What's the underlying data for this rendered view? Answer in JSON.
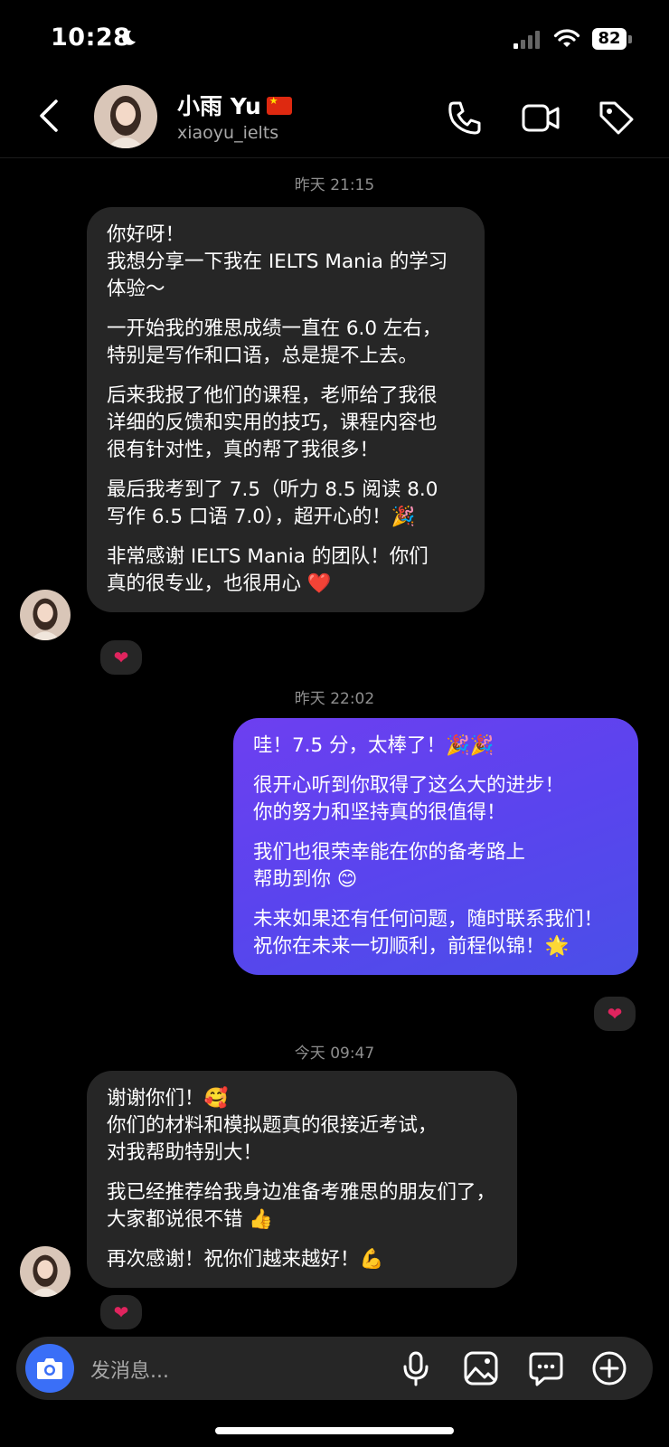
{
  "status_bar": {
    "time": "10:28",
    "battery": "82"
  },
  "header": {
    "name": "小雨 Yu",
    "username": "xiaoyu_ielts"
  },
  "messages": [
    {
      "timestamp": "昨天 21:15",
      "paragraphs": [
        "你好呀！\n我想分享一下我在 IELTS Mania 的学习\n体验～",
        "一开始我的雅思成绩一直在 6.0 左右，\n特别是写作和口语，总是提不上去。",
        "后来我报了他们的课程，老师给了我很\n详细的反馈和实用的技巧，课程内容也\n很有针对性，真的帮了我很多！",
        "最后我考到了 7.5（听力 8.5 阅读 8.0\n写作 6.5 口语 7.0），超开心的！🎉",
        "非常感谢 IELTS Mania 的团队！你们\n真的很专业，也很用心 ❤️"
      ],
      "reaction": "❤"
    },
    {
      "timestamp": "昨天 22:02",
      "paragraphs": [
        "哇！7.5 分，太棒了！🎉🎉",
        "很开心听到你取得了这么大的进步！\n你的努力和坚持真的很值得！",
        "我们也很荣幸能在你的备考路上\n帮助到你 😊",
        "未来如果还有任何问题，随时联系我们！\n祝你在未来一切顺利，前程似锦！🌟"
      ],
      "reaction": "❤"
    },
    {
      "timestamp": "今天 09:47",
      "paragraphs": [
        "谢谢你们！🥰\n你们的材料和模拟题真的很接近考试，\n对我帮助特别大！",
        "我已经推荐给我身边准备考雅思的朋友们了，\n大家都说很不错 👍",
        "再次感谢！祝你们越来越好！💪"
      ],
      "reaction": "❤"
    }
  ],
  "composer": {
    "placeholder": "发消息..."
  },
  "colors": {
    "accent": "#3a6ff7",
    "outgoing_start": "#6d3ff0",
    "outgoing_end": "#4a4fe8",
    "incoming": "#262626",
    "heart": "#e0245e"
  },
  "icons": [
    "moon-icon",
    "cellular-signal-icon",
    "wifi-icon",
    "battery-icon",
    "back-arrow-icon",
    "phone-icon",
    "video-camera-icon",
    "tag-icon",
    "camera-icon",
    "microphone-icon",
    "image-icon",
    "sticker-icon",
    "plus-circle-icon"
  ]
}
